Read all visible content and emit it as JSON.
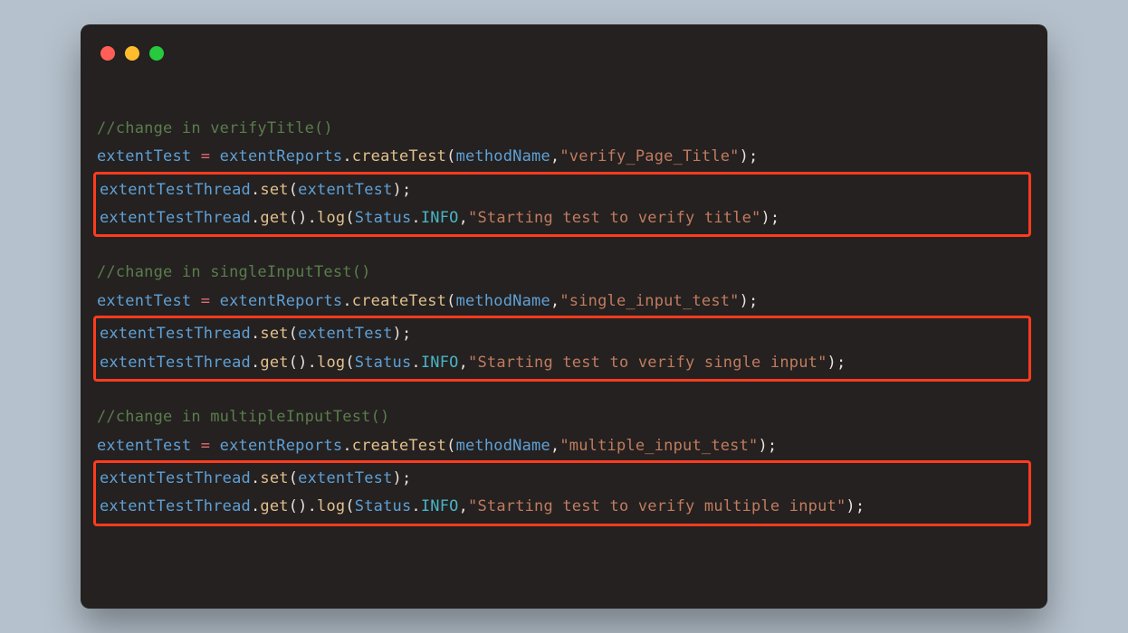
{
  "colors": {
    "windowBg": "#242120",
    "pageBg": "#b5c1cc",
    "highlight": "#ff3b1f",
    "dotRed": "#ff5f56",
    "dotYellow": "#ffbd2e",
    "dotGreen": "#27c93f"
  },
  "tokens": {
    "comment1": "//change in verifyTitle()",
    "comment2": "//change in singleInputTest()",
    "comment3": "//change in multipleInputTest()",
    "extentTest": "extentTest",
    "sp": " ",
    "eq": "=",
    "extentReports": "extentReports",
    "dot": ".",
    "createTest": "createTest",
    "lparen": "(",
    "methodName": "methodName",
    "comma": ",",
    "str_verify_page_title": "\"verify_Page_Title\"",
    "str_single_input_test": "\"single_input_test\"",
    "str_multiple_input_test": "\"multiple_input_test\"",
    "rpsemi": ");",
    "extentTestThread": "extentTestThread",
    "set": "set",
    "get": "get",
    "emptyArgs": "()",
    "log": "log",
    "Status": "Status",
    "INFO": "INFO",
    "str_start_title": "\"Starting test to verify title\"",
    "str_start_single": "\"Starting test to verify single input\"",
    "str_start_multiple": "\"Starting test to verify multiple input\""
  }
}
